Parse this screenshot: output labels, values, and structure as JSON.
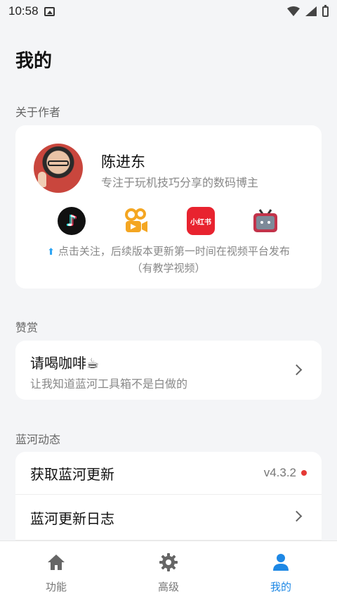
{
  "status_bar": {
    "time": "10:58"
  },
  "page": {
    "title": "我的"
  },
  "about": {
    "section_label": "关于作者",
    "name": "陈进东",
    "description": "专注于玩机技巧分享的数码博主",
    "platforms": [
      {
        "icon": "tiktok-icon"
      },
      {
        "icon": "kuaishou-icon"
      },
      {
        "icon": "xiaohongshu-icon",
        "text": "小红书"
      },
      {
        "icon": "bilibili-icon"
      }
    ],
    "follow_line1": "点击关注，后续版本更新第一时间在视频平台发布",
    "follow_line2": "（有教学视频）"
  },
  "appreciate": {
    "section_label": "赞赏",
    "title": "请喝咖啡☕",
    "subtitle": "让我知道蓝河工具箱不是白做的"
  },
  "updates": {
    "section_label": "蓝河动态",
    "get_update": "获取蓝河更新",
    "version": "v4.3.2",
    "changelog": "蓝河更新日志"
  },
  "bottom_nav": [
    {
      "label": "功能",
      "icon": "home-icon",
      "active": false
    },
    {
      "label": "高级",
      "icon": "gear-icon",
      "active": false
    },
    {
      "label": "我的",
      "icon": "person-icon",
      "active": true
    }
  ],
  "colors": {
    "accent": "#1e88e5",
    "badge": "#e53935"
  }
}
